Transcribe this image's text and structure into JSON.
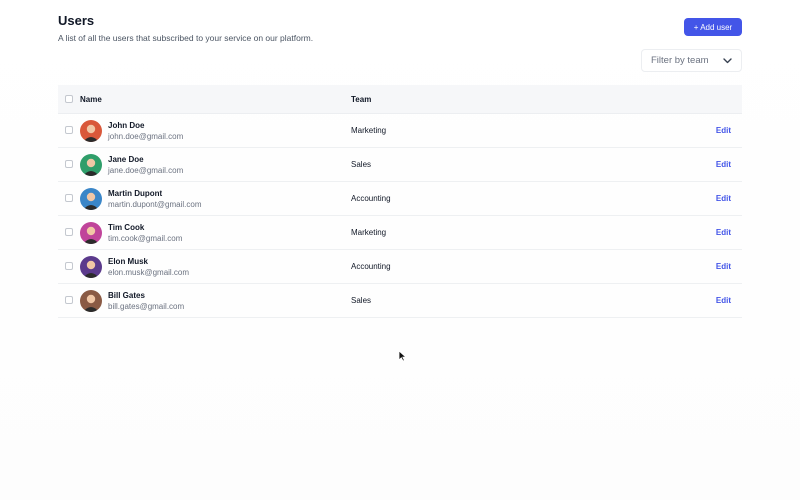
{
  "header": {
    "title": "Users",
    "subtitle": "A list of all the users that subscribed to your service on our platform.",
    "add_button": "+ Add user"
  },
  "filter": {
    "label": "Filter by team",
    "icon": "chevron-down-icon"
  },
  "table": {
    "columns": [
      "Name",
      "Team"
    ],
    "rows": [
      {
        "name": "John Doe",
        "email": "john.doe@gmail.com",
        "team": "Marketing",
        "action": "Edit",
        "avatar_color": "#d9583a"
      },
      {
        "name": "Jane Doe",
        "email": "jane.doe@gmail.com",
        "team": "Sales",
        "action": "Edit",
        "avatar_color": "#2f9e6a"
      },
      {
        "name": "Martin Dupont",
        "email": "martin.dupont@gmail.com",
        "team": "Accounting",
        "action": "Edit",
        "avatar_color": "#3a86c8"
      },
      {
        "name": "Tim Cook",
        "email": "tim.cook@gmail.com",
        "team": "Marketing",
        "action": "Edit",
        "avatar_color": "#c0449a"
      },
      {
        "name": "Elon Musk",
        "email": "elon.musk@gmail.com",
        "team": "Accounting",
        "action": "Edit",
        "avatar_color": "#5b3a8c"
      },
      {
        "name": "Bill Gates",
        "email": "bill.gates@gmail.com",
        "team": "Sales",
        "action": "Edit",
        "avatar_color": "#8a5a44"
      }
    ]
  },
  "colors": {
    "accent": "#4355e8",
    "header_bg": "#f6f7f9"
  }
}
